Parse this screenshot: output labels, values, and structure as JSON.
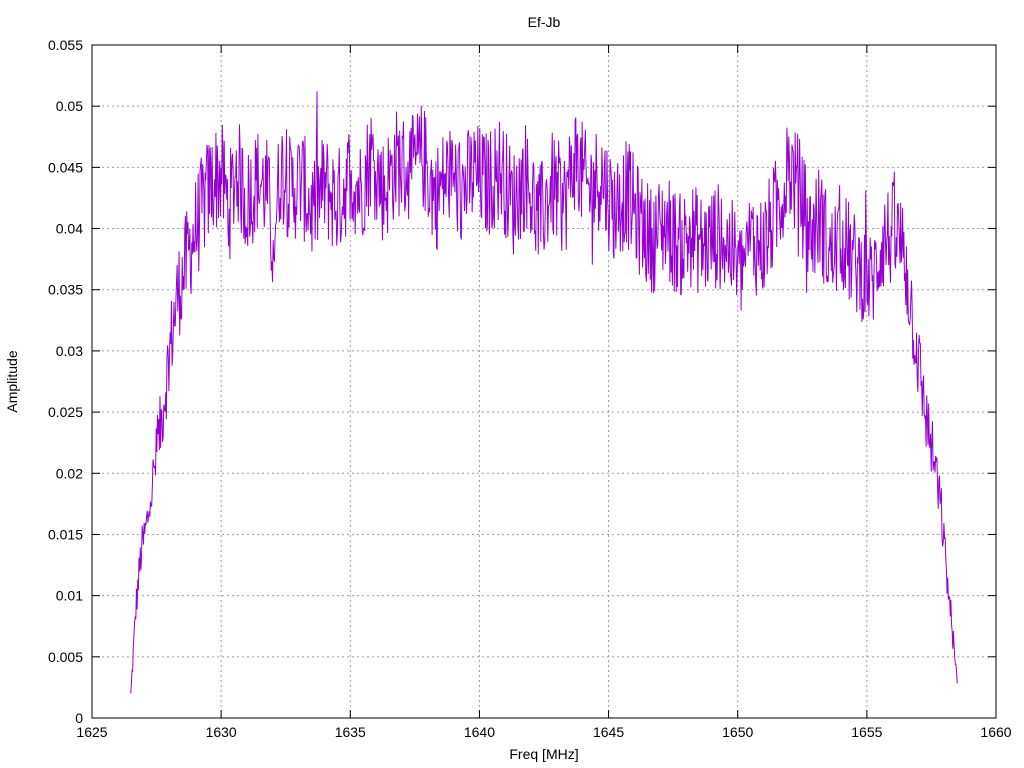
{
  "chart_data": {
    "type": "line",
    "title": "Ef-Jb",
    "xlabel": "Freq [MHz]",
    "ylabel": "Amplitude",
    "xlim": [
      1625,
      1660
    ],
    "ylim": [
      0,
      0.055
    ],
    "x_ticks": [
      1625,
      1630,
      1635,
      1640,
      1645,
      1650,
      1655,
      1660
    ],
    "x_tick_labels": [
      "1625",
      "1630",
      "1635",
      "1640",
      "1645",
      "1650",
      "1655",
      "1660"
    ],
    "y_ticks": [
      0,
      0.005,
      0.01,
      0.015,
      0.02,
      0.025,
      0.03,
      0.035,
      0.04,
      0.045,
      0.05,
      0.055
    ],
    "y_tick_labels": [
      "0",
      "0.005",
      "0.01",
      "0.015",
      "0.02",
      "0.025",
      "0.03",
      "0.035",
      "0.04",
      "0.045",
      "0.05",
      "0.055"
    ],
    "grid": true,
    "legend": "none",
    "line_color": "#9400d3",
    "series": [
      {
        "x": [
          1626.5,
          1626.7,
          1626.9,
          1627.1,
          1627.3,
          1627.5,
          1627.7,
          1627.9,
          1628.1,
          1628.3,
          1628.5,
          1628.8,
          1629.1,
          1629.4,
          1629.7,
          1630.0,
          1630.3,
          1630.6,
          1631.0,
          1631.4,
          1631.8,
          1632.0,
          1632.3,
          1632.7,
          1633.1,
          1633.5,
          1634.0,
          1634.5,
          1635.0,
          1635.4,
          1635.8,
          1636.3,
          1636.8,
          1637.3,
          1637.8,
          1638.3,
          1638.8,
          1639.3,
          1639.8,
          1640.3,
          1640.8,
          1641.3,
          1641.8,
          1642.3,
          1642.8,
          1643.3,
          1643.7,
          1644.2,
          1644.7,
          1645.2,
          1645.7,
          1646.2,
          1646.7,
          1647.2,
          1647.7,
          1648.2,
          1648.7,
          1649.2,
          1649.7,
          1650.1,
          1650.5,
          1651.0,
          1651.5,
          1652.0,
          1652.4,
          1652.8,
          1653.2,
          1653.6,
          1654.0,
          1654.4,
          1654.8,
          1655.2,
          1655.6,
          1656.0,
          1656.4,
          1656.7,
          1657.0,
          1657.3,
          1657.6,
          1657.9,
          1658.1,
          1658.3,
          1658.5
        ],
        "y": [
          0.0018,
          0.009,
          0.0135,
          0.0155,
          0.0185,
          0.0215,
          0.0245,
          0.028,
          0.0315,
          0.0345,
          0.036,
          0.0385,
          0.0405,
          0.0425,
          0.044,
          0.0445,
          0.0415,
          0.045,
          0.042,
          0.044,
          0.043,
          0.0385,
          0.045,
          0.043,
          0.044,
          0.0415,
          0.0435,
          0.042,
          0.0445,
          0.043,
          0.046,
          0.043,
          0.0455,
          0.0445,
          0.046,
          0.0425,
          0.0445,
          0.043,
          0.0445,
          0.0435,
          0.045,
          0.042,
          0.0445,
          0.0405,
          0.0435,
          0.042,
          0.046,
          0.043,
          0.0445,
          0.0415,
          0.043,
          0.0405,
          0.039,
          0.0405,
          0.0385,
          0.0395,
          0.0385,
          0.0395,
          0.0385,
          0.0365,
          0.039,
          0.0385,
          0.0415,
          0.045,
          0.043,
          0.0395,
          0.041,
          0.0375,
          0.0395,
          0.0375,
          0.0365,
          0.0355,
          0.039,
          0.0395,
          0.0385,
          0.034,
          0.029,
          0.0245,
          0.021,
          0.0165,
          0.0115,
          0.0075,
          0.0025
        ]
      }
    ]
  }
}
